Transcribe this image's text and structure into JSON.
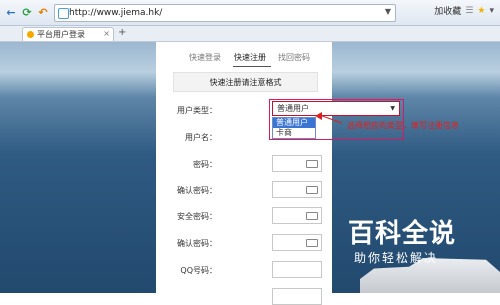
{
  "browser": {
    "url": "http://www.jiema.hk/",
    "favorites_label": "加收藏",
    "tab_title": "平台用户登录",
    "tab_close": "×",
    "new_tab": "+"
  },
  "form": {
    "tabs": [
      "快速登录",
      "快速注册",
      "找回密码"
    ],
    "notice": "快速注册请注意格式",
    "user_type_label": "用户类型：",
    "user_type_value": "普通用户",
    "user_type_options": [
      "普通用户",
      "卡商"
    ],
    "labels": [
      "用户名：",
      "密码：",
      "确认密码：",
      "安全密码：",
      "确认密码：",
      "QQ号码："
    ]
  },
  "annotation": "选择相应的类型，填写注册信息",
  "watermark": {
    "title": "百科全说",
    "subtitle": "助你轻松解决"
  }
}
